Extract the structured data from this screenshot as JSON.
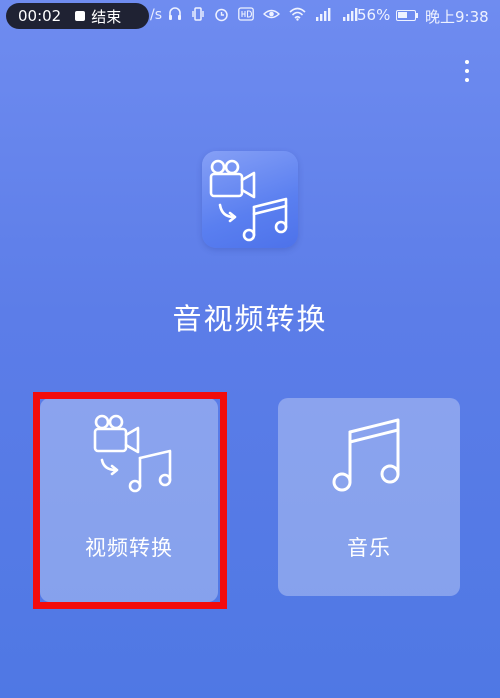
{
  "status_bar": {
    "recording_time": "00:02",
    "recording_stop_label": "结束",
    "net_speed": "/s",
    "battery_percent": "56%",
    "clock": "晚上9:38"
  },
  "app": {
    "title": "音视频转换"
  },
  "cards": {
    "video_convert_label": "视频转换",
    "music_label": "音乐"
  },
  "colors": {
    "background_top": "#6f8cf0",
    "background_bottom": "#4f78e4",
    "highlight": "#f20c0c"
  },
  "icons": {
    "app": "video-to-music-icon",
    "video_convert": "video-to-music-icon",
    "music": "music-note-icon",
    "more": "more-vertical-icon"
  }
}
